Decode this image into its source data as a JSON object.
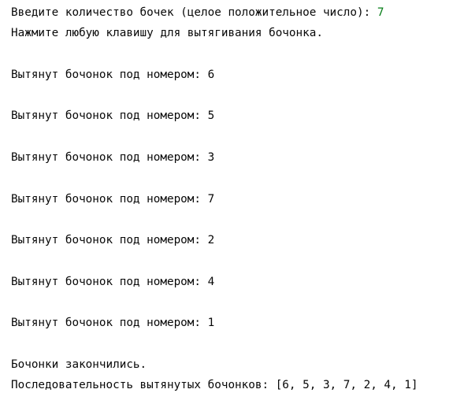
{
  "console": {
    "prompt_count": "Введите количество бочек (целое положительное число): ",
    "input_count": "7",
    "press_key": "Нажмите любую клавишу для вытягивания бочонка.",
    "draws": [
      "Вытянут бочонок под номером: 6",
      "Вытянут бочонок под номером: 5",
      "Вытянут бочонок под номером: 3",
      "Вытянут бочонок под номером: 7",
      "Вытянут бочонок под номером: 2",
      "Вытянут бочонок под номером: 4",
      "Вытянут бочонок под номером: 1"
    ],
    "finished": "Бочонки закончились.",
    "sequence": "Последовательность вытянутых бочонков: [6, 5, 3, 7, 2, 4, 1]"
  },
  "colors": {
    "text": "#080808",
    "user_input": "#067d17",
    "background": "#ffffff"
  }
}
